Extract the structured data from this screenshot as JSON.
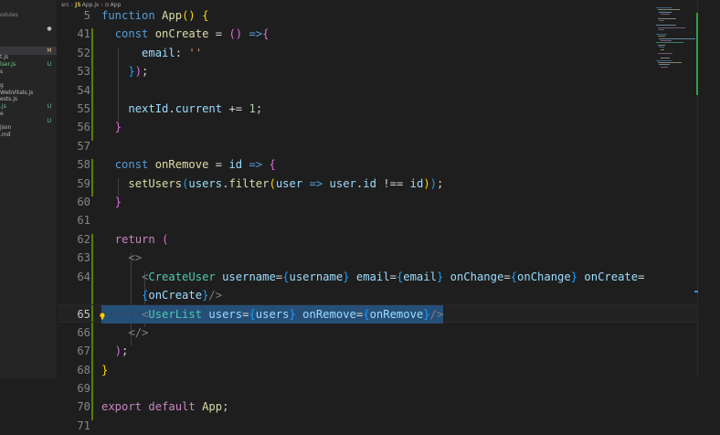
{
  "sidebar": {
    "rows": [
      {
        "name": "odules",
        "badge": "",
        "style": "dim"
      },
      {
        "name": "",
        "badge": "",
        "style": ""
      },
      {
        "name": "",
        "badge": "●",
        "style": "dim"
      },
      {
        "name": "",
        "badge": "",
        "style": ""
      },
      {
        "name": "",
        "badge": "",
        "style": ""
      },
      {
        "name": "",
        "badge": "M",
        "style": "hl"
      },
      {
        "name": "t.js",
        "badge": "",
        "style": ""
      },
      {
        "name": "lser.js",
        "badge": "U",
        "style": "green"
      },
      {
        "name": "s",
        "badge": "",
        "style": ""
      },
      {
        "name": "",
        "badge": "",
        "style": ""
      },
      {
        "name": "g",
        "badge": "",
        "style": ""
      },
      {
        "name": "WebVitals.js",
        "badge": "",
        "style": ""
      },
      {
        "name": "ests.js",
        "badge": "",
        "style": ""
      },
      {
        "name": ".js",
        "badge": "U",
        "style": "green"
      },
      {
        "name": "e",
        "badge": "",
        "style": ""
      },
      {
        "name": "",
        "badge": "U",
        "style": "green"
      },
      {
        "name": "json",
        "badge": "",
        "style": ""
      },
      {
        "name": ".md",
        "badge": "",
        "style": ""
      }
    ]
  },
  "breadcrumb": {
    "folder": "src",
    "file_icon": "JS",
    "file": "App.js",
    "symbol_icon": "⊙",
    "symbol": "App"
  },
  "editor": {
    "lines": [
      {
        "n": "5",
        "tokens": [
          [
            "kw",
            "function"
          ],
          [
            "txt",
            " "
          ],
          [
            "fn",
            "App"
          ],
          [
            "b1",
            "("
          ],
          [
            "b1",
            ")"
          ],
          [
            "txt",
            " "
          ],
          [
            "b1",
            "{"
          ]
        ]
      },
      {
        "n": "41",
        "tokens": [
          [
            "txt",
            "  "
          ],
          [
            "kw",
            "const"
          ],
          [
            "txt",
            " "
          ],
          [
            "fn",
            "onCreate"
          ],
          [
            "txt",
            " = "
          ],
          [
            "b2",
            "("
          ],
          [
            "b2",
            ")"
          ],
          [
            "txt",
            " "
          ],
          [
            "kw",
            "=>"
          ],
          [
            "b2",
            "{"
          ]
        ]
      },
      {
        "n": "52",
        "tokens": [
          [
            "txt",
            "      "
          ],
          [
            "var",
            "email"
          ],
          [
            "txt",
            ": "
          ],
          [
            "str",
            "''"
          ]
        ]
      },
      {
        "n": "53",
        "tokens": [
          [
            "txt",
            "    "
          ],
          [
            "b3",
            "}"
          ],
          [
            "b2",
            ")"
          ],
          [
            "txt",
            ";"
          ]
        ]
      },
      {
        "n": "54",
        "tokens": []
      },
      {
        "n": "55",
        "tokens": [
          [
            "txt",
            "    "
          ],
          [
            "var",
            "nextId"
          ],
          [
            "txt",
            "."
          ],
          [
            "var",
            "current"
          ],
          [
            "txt",
            " += "
          ],
          [
            "num",
            "1"
          ],
          [
            "txt",
            ";"
          ]
        ]
      },
      {
        "n": "56",
        "tokens": [
          [
            "txt",
            "  "
          ],
          [
            "b2",
            "}"
          ]
        ]
      },
      {
        "n": "57",
        "tokens": []
      },
      {
        "n": "58",
        "tokens": [
          [
            "txt",
            "  "
          ],
          [
            "kw",
            "const"
          ],
          [
            "txt",
            " "
          ],
          [
            "fn",
            "onRemove"
          ],
          [
            "txt",
            " = "
          ],
          [
            "var",
            "id"
          ],
          [
            "txt",
            " "
          ],
          [
            "kw",
            "=>"
          ],
          [
            "txt",
            " "
          ],
          [
            "b2",
            "{"
          ]
        ]
      },
      {
        "n": "59",
        "tokens": [
          [
            "txt",
            "    "
          ],
          [
            "fn",
            "setUsers"
          ],
          [
            "b3",
            "("
          ],
          [
            "var",
            "users"
          ],
          [
            "txt",
            "."
          ],
          [
            "fn",
            "filter"
          ],
          [
            "b1",
            "("
          ],
          [
            "var",
            "user"
          ],
          [
            "txt",
            " "
          ],
          [
            "kw",
            "=>"
          ],
          [
            "txt",
            " "
          ],
          [
            "var",
            "user"
          ],
          [
            "txt",
            "."
          ],
          [
            "var",
            "id"
          ],
          [
            "txt",
            " !== "
          ],
          [
            "var",
            "id"
          ],
          [
            "b1",
            ")"
          ],
          [
            "b3",
            ")"
          ],
          [
            "txt",
            ";"
          ]
        ]
      },
      {
        "n": "60",
        "tokens": [
          [
            "txt",
            "  "
          ],
          [
            "b2",
            "}"
          ]
        ]
      },
      {
        "n": "61",
        "tokens": []
      },
      {
        "n": "62",
        "tokens": [
          [
            "txt",
            "  "
          ],
          [
            "ctl",
            "return"
          ],
          [
            "txt",
            " "
          ],
          [
            "b2",
            "("
          ]
        ]
      },
      {
        "n": "63",
        "tokens": [
          [
            "txt",
            "    "
          ],
          [
            "pun",
            "<>"
          ]
        ]
      },
      {
        "n": "64",
        "tokens": [
          [
            "txt",
            "      "
          ],
          [
            "pun",
            "<"
          ],
          [
            "tag",
            "CreateUser"
          ],
          [
            "txt",
            " "
          ],
          [
            "var",
            "username"
          ],
          [
            "txt",
            "="
          ],
          [
            "b3",
            "{"
          ],
          [
            "var",
            "username"
          ],
          [
            "b3",
            "}"
          ],
          [
            "txt",
            " "
          ],
          [
            "var",
            "email"
          ],
          [
            "txt",
            "="
          ],
          [
            "b3",
            "{"
          ],
          [
            "var",
            "email"
          ],
          [
            "b3",
            "}"
          ],
          [
            "txt",
            " "
          ],
          [
            "var",
            "onChange"
          ],
          [
            "txt",
            "="
          ],
          [
            "b3",
            "{"
          ],
          [
            "var",
            "onChange"
          ],
          [
            "b3",
            "}"
          ],
          [
            "txt",
            " "
          ],
          [
            "var",
            "onCreate"
          ],
          [
            "txt",
            "="
          ]
        ]
      },
      {
        "n": "",
        "tokens": [
          [
            "txt",
            "      "
          ],
          [
            "b3",
            "{"
          ],
          [
            "var",
            "onCreate"
          ],
          [
            "b3",
            "}"
          ],
          [
            "pun",
            "/>"
          ]
        ]
      },
      {
        "n": "65",
        "active": true,
        "tokens": [
          [
            "ws",
            "······"
          ],
          [
            "pun",
            "<"
          ],
          [
            "tag",
            "UserList"
          ],
          [
            "ws",
            "·"
          ],
          [
            "var",
            "users"
          ],
          [
            "txt",
            "="
          ],
          [
            "b3",
            "{"
          ],
          [
            "var",
            "users"
          ],
          [
            "b3",
            "}"
          ],
          [
            "ws",
            "·"
          ],
          [
            "var",
            "onRemove"
          ],
          [
            "txt",
            "="
          ],
          [
            "b3",
            "{"
          ],
          [
            "var",
            "onRemove"
          ],
          [
            "b3",
            "}"
          ],
          [
            "pun",
            "/>"
          ]
        ]
      },
      {
        "n": "66",
        "tokens": [
          [
            "txt",
            "    "
          ],
          [
            "pun",
            "</>"
          ]
        ]
      },
      {
        "n": "67",
        "tokens": [
          [
            "txt",
            "  "
          ],
          [
            "b2",
            ")"
          ],
          [
            "txt",
            ";"
          ]
        ]
      },
      {
        "n": "68",
        "tokens": [
          [
            "b1",
            "}"
          ]
        ]
      },
      {
        "n": "69",
        "tokens": []
      },
      {
        "n": "70",
        "tokens": [
          [
            "ctl",
            "export"
          ],
          [
            "txt",
            " "
          ],
          [
            "ctl",
            "default"
          ],
          [
            "txt",
            " "
          ],
          [
            "fn",
            "App"
          ],
          [
            "txt",
            ";"
          ]
        ]
      },
      {
        "n": "71",
        "tokens": []
      }
    ]
  },
  "colors": {
    "background": "#1e1e1e",
    "selection": "#264f78",
    "gutter_added": "#587c0c"
  }
}
